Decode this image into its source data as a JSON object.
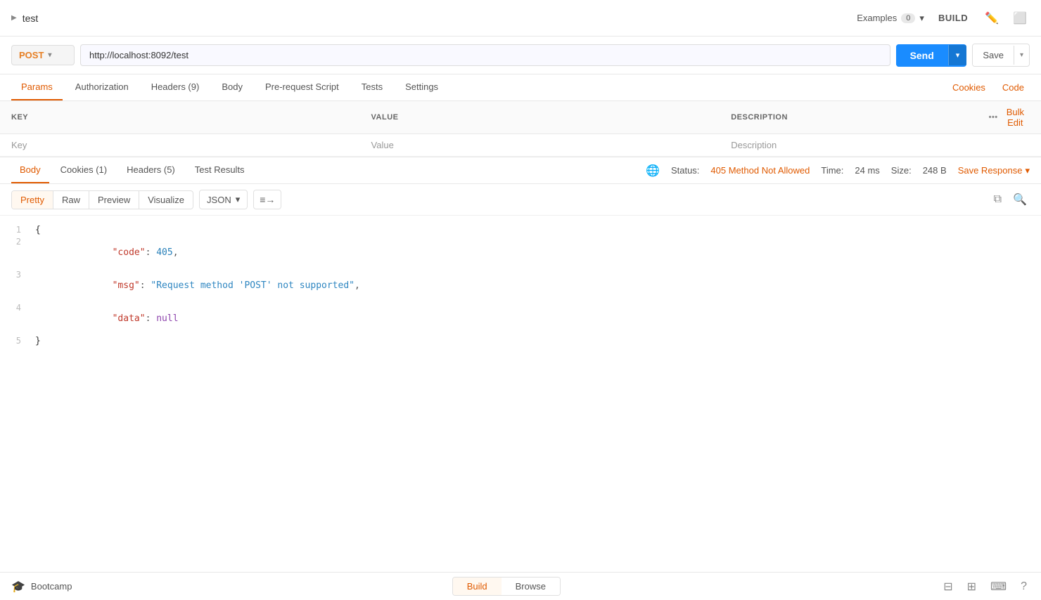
{
  "topbar": {
    "title": "test",
    "examples_label": "Examples",
    "examples_count": "0",
    "build_label": "BUILD"
  },
  "urlbar": {
    "method": "POST",
    "url": "http://localhost:8092/test",
    "send_label": "Send",
    "save_label": "Save"
  },
  "request_tabs": {
    "tabs": [
      {
        "id": "params",
        "label": "Params",
        "active": true,
        "badge": ""
      },
      {
        "id": "authorization",
        "label": "Authorization",
        "active": false,
        "badge": ""
      },
      {
        "id": "headers",
        "label": "Headers (9)",
        "active": false,
        "badge": ""
      },
      {
        "id": "body",
        "label": "Body",
        "active": false,
        "badge": ""
      },
      {
        "id": "pre-request",
        "label": "Pre-request Script",
        "active": false,
        "badge": ""
      },
      {
        "id": "tests",
        "label": "Tests",
        "active": false,
        "badge": ""
      },
      {
        "id": "settings",
        "label": "Settings",
        "active": false,
        "badge": ""
      }
    ],
    "cookies_label": "Cookies",
    "code_label": "Code"
  },
  "params_table": {
    "columns": [
      "KEY",
      "VALUE",
      "DESCRIPTION"
    ],
    "rows": [
      {
        "key": "Key",
        "value": "Value",
        "description": "Description"
      }
    ],
    "bulk_edit_label": "Bulk Edit"
  },
  "response": {
    "tabs": [
      {
        "id": "body",
        "label": "Body",
        "active": true
      },
      {
        "id": "cookies",
        "label": "Cookies (1)",
        "active": false
      },
      {
        "id": "headers",
        "label": "Headers (5)",
        "active": false
      },
      {
        "id": "test-results",
        "label": "Test Results",
        "active": false
      }
    ],
    "status_label": "Status:",
    "status_value": "405 Method Not Allowed",
    "time_label": "Time:",
    "time_value": "24 ms",
    "size_label": "Size:",
    "size_value": "248 B",
    "save_response_label": "Save Response"
  },
  "response_body": {
    "format_tabs": [
      "Pretty",
      "Raw",
      "Preview",
      "Visualize"
    ],
    "active_format": "Pretty",
    "json_format": "JSON",
    "lines": [
      {
        "num": 1,
        "content": "{",
        "type": "brace"
      },
      {
        "num": 2,
        "content": "    \"code\": 405,",
        "type": "key-number"
      },
      {
        "num": 3,
        "content": "    \"msg\": \"Request method 'POST' not supported\",",
        "type": "key-string"
      },
      {
        "num": 4,
        "content": "    \"data\": null",
        "type": "key-null"
      },
      {
        "num": 5,
        "content": "}",
        "type": "brace"
      }
    ]
  },
  "bottom_bar": {
    "bootcamp_label": "Bootcamp",
    "build_label": "Build",
    "browse_label": "Browse"
  }
}
